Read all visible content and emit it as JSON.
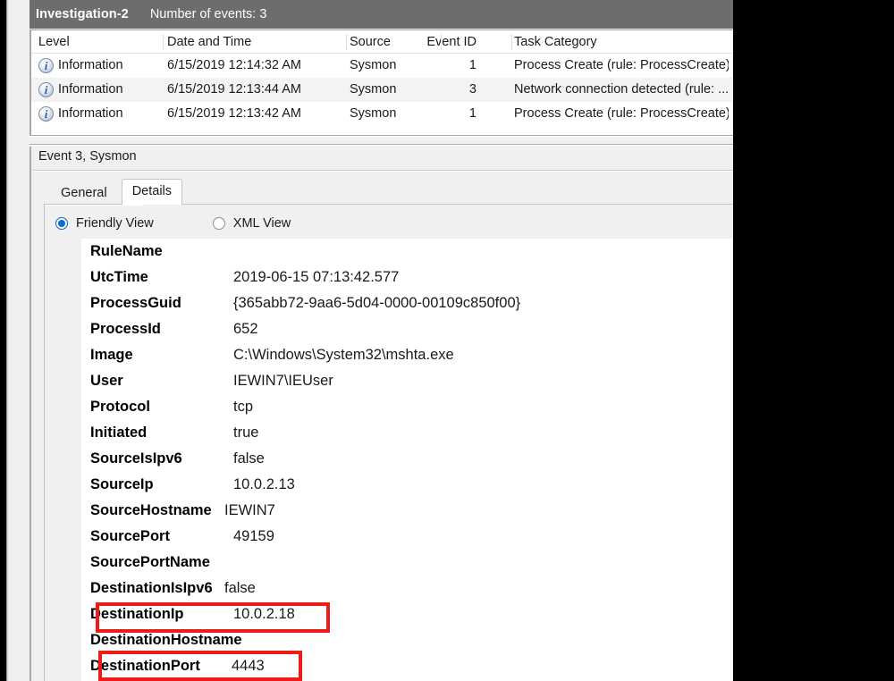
{
  "window": {
    "title": "Investigation-2",
    "event_count_label": "Number of events: 3"
  },
  "events_list": {
    "columns": [
      "Level",
      "Date and Time",
      "Source",
      "Event ID",
      "Task Category"
    ],
    "rows": [
      {
        "icon": "information-icon",
        "level": "Information",
        "datetime": "6/15/2019 12:14:32 AM",
        "source": "Sysmon",
        "event_id": "1",
        "task_category": "Process Create (rule: ProcessCreate)",
        "selected": false
      },
      {
        "icon": "information-icon",
        "level": "Information",
        "datetime": "6/15/2019 12:13:44 AM",
        "source": "Sysmon",
        "event_id": "3",
        "task_category": "Network connection detected (rule: ...",
        "selected": true
      },
      {
        "icon": "information-icon",
        "level": "Information",
        "datetime": "6/15/2019 12:13:42 AM",
        "source": "Sysmon",
        "event_id": "1",
        "task_category": "Process Create (rule: ProcessCreate)",
        "selected": false
      }
    ]
  },
  "details": {
    "caption": "Event 3, Sysmon",
    "tabs": [
      {
        "label": "General",
        "active": false
      },
      {
        "label": "Details",
        "active": true
      }
    ],
    "view_options": [
      {
        "label": "Friendly View",
        "selected": true
      },
      {
        "label": "XML View",
        "selected": false
      }
    ],
    "fields": [
      {
        "name": "RuleName",
        "value": ""
      },
      {
        "name": "UtcTime",
        "value": "2019-06-15 07:13:42.577"
      },
      {
        "name": "ProcessGuid",
        "value": "{365abb72-9aa6-5d04-0000-00109c850f00}"
      },
      {
        "name": "ProcessId",
        "value": "652"
      },
      {
        "name": "Image",
        "value": "C:\\Windows\\System32\\mshta.exe"
      },
      {
        "name": "User",
        "value": "IEWIN7\\IEUser"
      },
      {
        "name": "Protocol",
        "value": "tcp"
      },
      {
        "name": "Initiated",
        "value": "true"
      },
      {
        "name": "SourceIsIpv6",
        "value": "false"
      },
      {
        "name": "SourceIp",
        "value": "10.0.2.13"
      },
      {
        "name": "SourceHostname",
        "value": "IEWIN7",
        "tight": true
      },
      {
        "name": "SourcePort",
        "value": "49159"
      },
      {
        "name": "SourcePortName",
        "value": ""
      },
      {
        "name": "DestinationIsIpv6",
        "value": "false",
        "tight": true
      },
      {
        "name": "DestinationIp",
        "value": "10.0.2.18"
      },
      {
        "name": "DestinationHostname",
        "value": ""
      },
      {
        "name": "DestinationPort",
        "value": "4443",
        "tight": true
      }
    ]
  },
  "annotations": {
    "highlight_color": "#ee1b16",
    "boxes": [
      {
        "target": "DestinationIp",
        "label": "destination-ip-highlight"
      },
      {
        "target": "DestinationPort",
        "label": "destination-port-highlight"
      }
    ]
  }
}
